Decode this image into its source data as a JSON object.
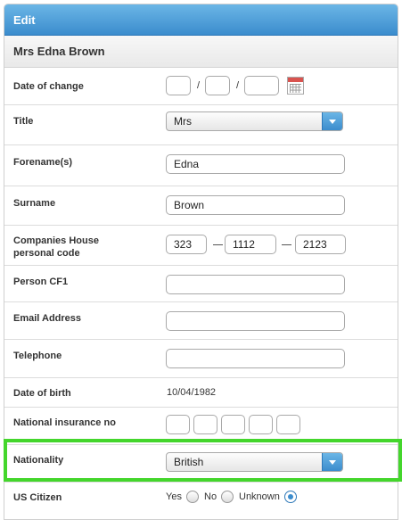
{
  "header": {
    "title": "Edit"
  },
  "person": {
    "name": "Mrs Edna Brown"
  },
  "fields": {
    "date_of_change": {
      "label": "Date of change",
      "day": "",
      "month": "",
      "year": "",
      "separator": "/"
    },
    "title": {
      "label": "Title",
      "selected": "Mrs"
    },
    "forename": {
      "label": "Forename(s)",
      "value": "Edna"
    },
    "surname": {
      "label": "Surname",
      "value": "Brown"
    },
    "ch_code": {
      "label_line1": "Companies House",
      "label_line2": "personal code",
      "part1": "323",
      "part2": "1112",
      "part3": "2123"
    },
    "person_cf1": {
      "label": "Person CF1",
      "value": ""
    },
    "email": {
      "label": "Email Address",
      "value": ""
    },
    "telephone": {
      "label": "Telephone",
      "value": ""
    },
    "dob": {
      "label": "Date of birth",
      "value": "10/04/1982"
    },
    "ni": {
      "label": "National insurance no",
      "parts": [
        "",
        "",
        "",
        "",
        ""
      ]
    },
    "nationality": {
      "label": "Nationality",
      "selected": "British"
    },
    "us_citizen": {
      "label": "US Citizen",
      "options": [
        "Yes",
        "No",
        "Unknown"
      ],
      "selected": "Unknown"
    }
  },
  "icons": {
    "calendar": "calendar-icon",
    "dropdown": "chevron-down-icon"
  },
  "colors": {
    "header": "#3b8ccd",
    "highlight": "#44d62c"
  }
}
